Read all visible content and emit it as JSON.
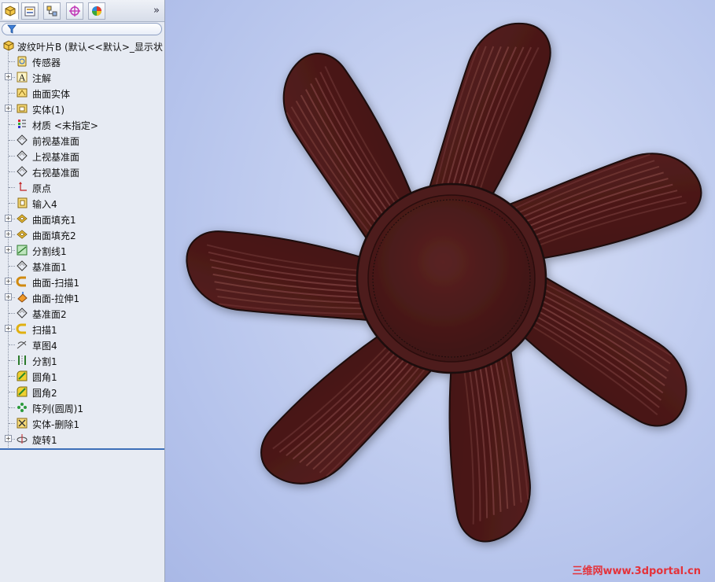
{
  "tabs": [
    {
      "name": "feature-manager-tab",
      "icon": "feature-tree-icon"
    },
    {
      "name": "property-manager-tab",
      "icon": "property-icon"
    },
    {
      "name": "configuration-manager-tab",
      "icon": "configuration-icon"
    },
    {
      "name": "dimxpert-tab",
      "icon": "target-icon"
    },
    {
      "name": "display-manager-tab",
      "icon": "color-wheel-icon"
    }
  ],
  "more_label": "»",
  "tree": {
    "root_label": "波纹叶片B  (默认<<默认>_显示状",
    "items": [
      {
        "label": "传感器",
        "icon": "sensor-icon",
        "expandable": false
      },
      {
        "label": "注解",
        "icon": "annotation-icon",
        "expandable": true
      },
      {
        "label": "曲面实体",
        "icon": "surface-body-icon",
        "expandable": false
      },
      {
        "label": "实体(1)",
        "icon": "solid-body-icon",
        "expandable": true
      },
      {
        "label": "材质 <未指定>",
        "icon": "material-icon",
        "expandable": false
      },
      {
        "label": "前视基准面",
        "icon": "plane-icon",
        "expandable": false
      },
      {
        "label": "上视基准面",
        "icon": "plane-icon",
        "expandable": false
      },
      {
        "label": "右视基准面",
        "icon": "plane-icon",
        "expandable": false
      },
      {
        "label": "原点",
        "icon": "origin-icon",
        "expandable": false
      },
      {
        "label": "输入4",
        "icon": "import-icon",
        "expandable": false
      },
      {
        "label": "曲面填充1",
        "icon": "surface-fill-icon",
        "expandable": true
      },
      {
        "label": "曲面填充2",
        "icon": "surface-fill-icon",
        "expandable": true
      },
      {
        "label": "分割线1",
        "icon": "split-line-icon",
        "expandable": true
      },
      {
        "label": "基准面1",
        "icon": "plane-icon",
        "expandable": false
      },
      {
        "label": "曲面-扫描1",
        "icon": "surface-sweep-icon",
        "expandable": true
      },
      {
        "label": "曲面-拉伸1",
        "icon": "surface-extrude-icon",
        "expandable": true
      },
      {
        "label": "基准面2",
        "icon": "plane-icon",
        "expandable": false
      },
      {
        "label": "扫描1",
        "icon": "sweep-icon",
        "expandable": true
      },
      {
        "label": "草图4",
        "icon": "sketch-icon",
        "expandable": false
      },
      {
        "label": "分割1",
        "icon": "split-icon",
        "expandable": false
      },
      {
        "label": "圆角1",
        "icon": "fillet-icon",
        "expandable": false
      },
      {
        "label": "圆角2",
        "icon": "fillet-icon",
        "expandable": false
      },
      {
        "label": "阵列(圆周)1",
        "icon": "circular-pattern-icon",
        "expandable": false
      },
      {
        "label": "实体-删除1",
        "icon": "delete-body-icon",
        "expandable": false
      },
      {
        "label": "旋转1",
        "icon": "revolve-icon",
        "expandable": true
      }
    ]
  },
  "watermark": "三维网www.3dportal.cn",
  "colors": {
    "blade": "#4a1a19",
    "blade_highlight": "#8a4b4a",
    "hub": "#4d1b1b",
    "viewport_bg": "#b9c6ee"
  }
}
